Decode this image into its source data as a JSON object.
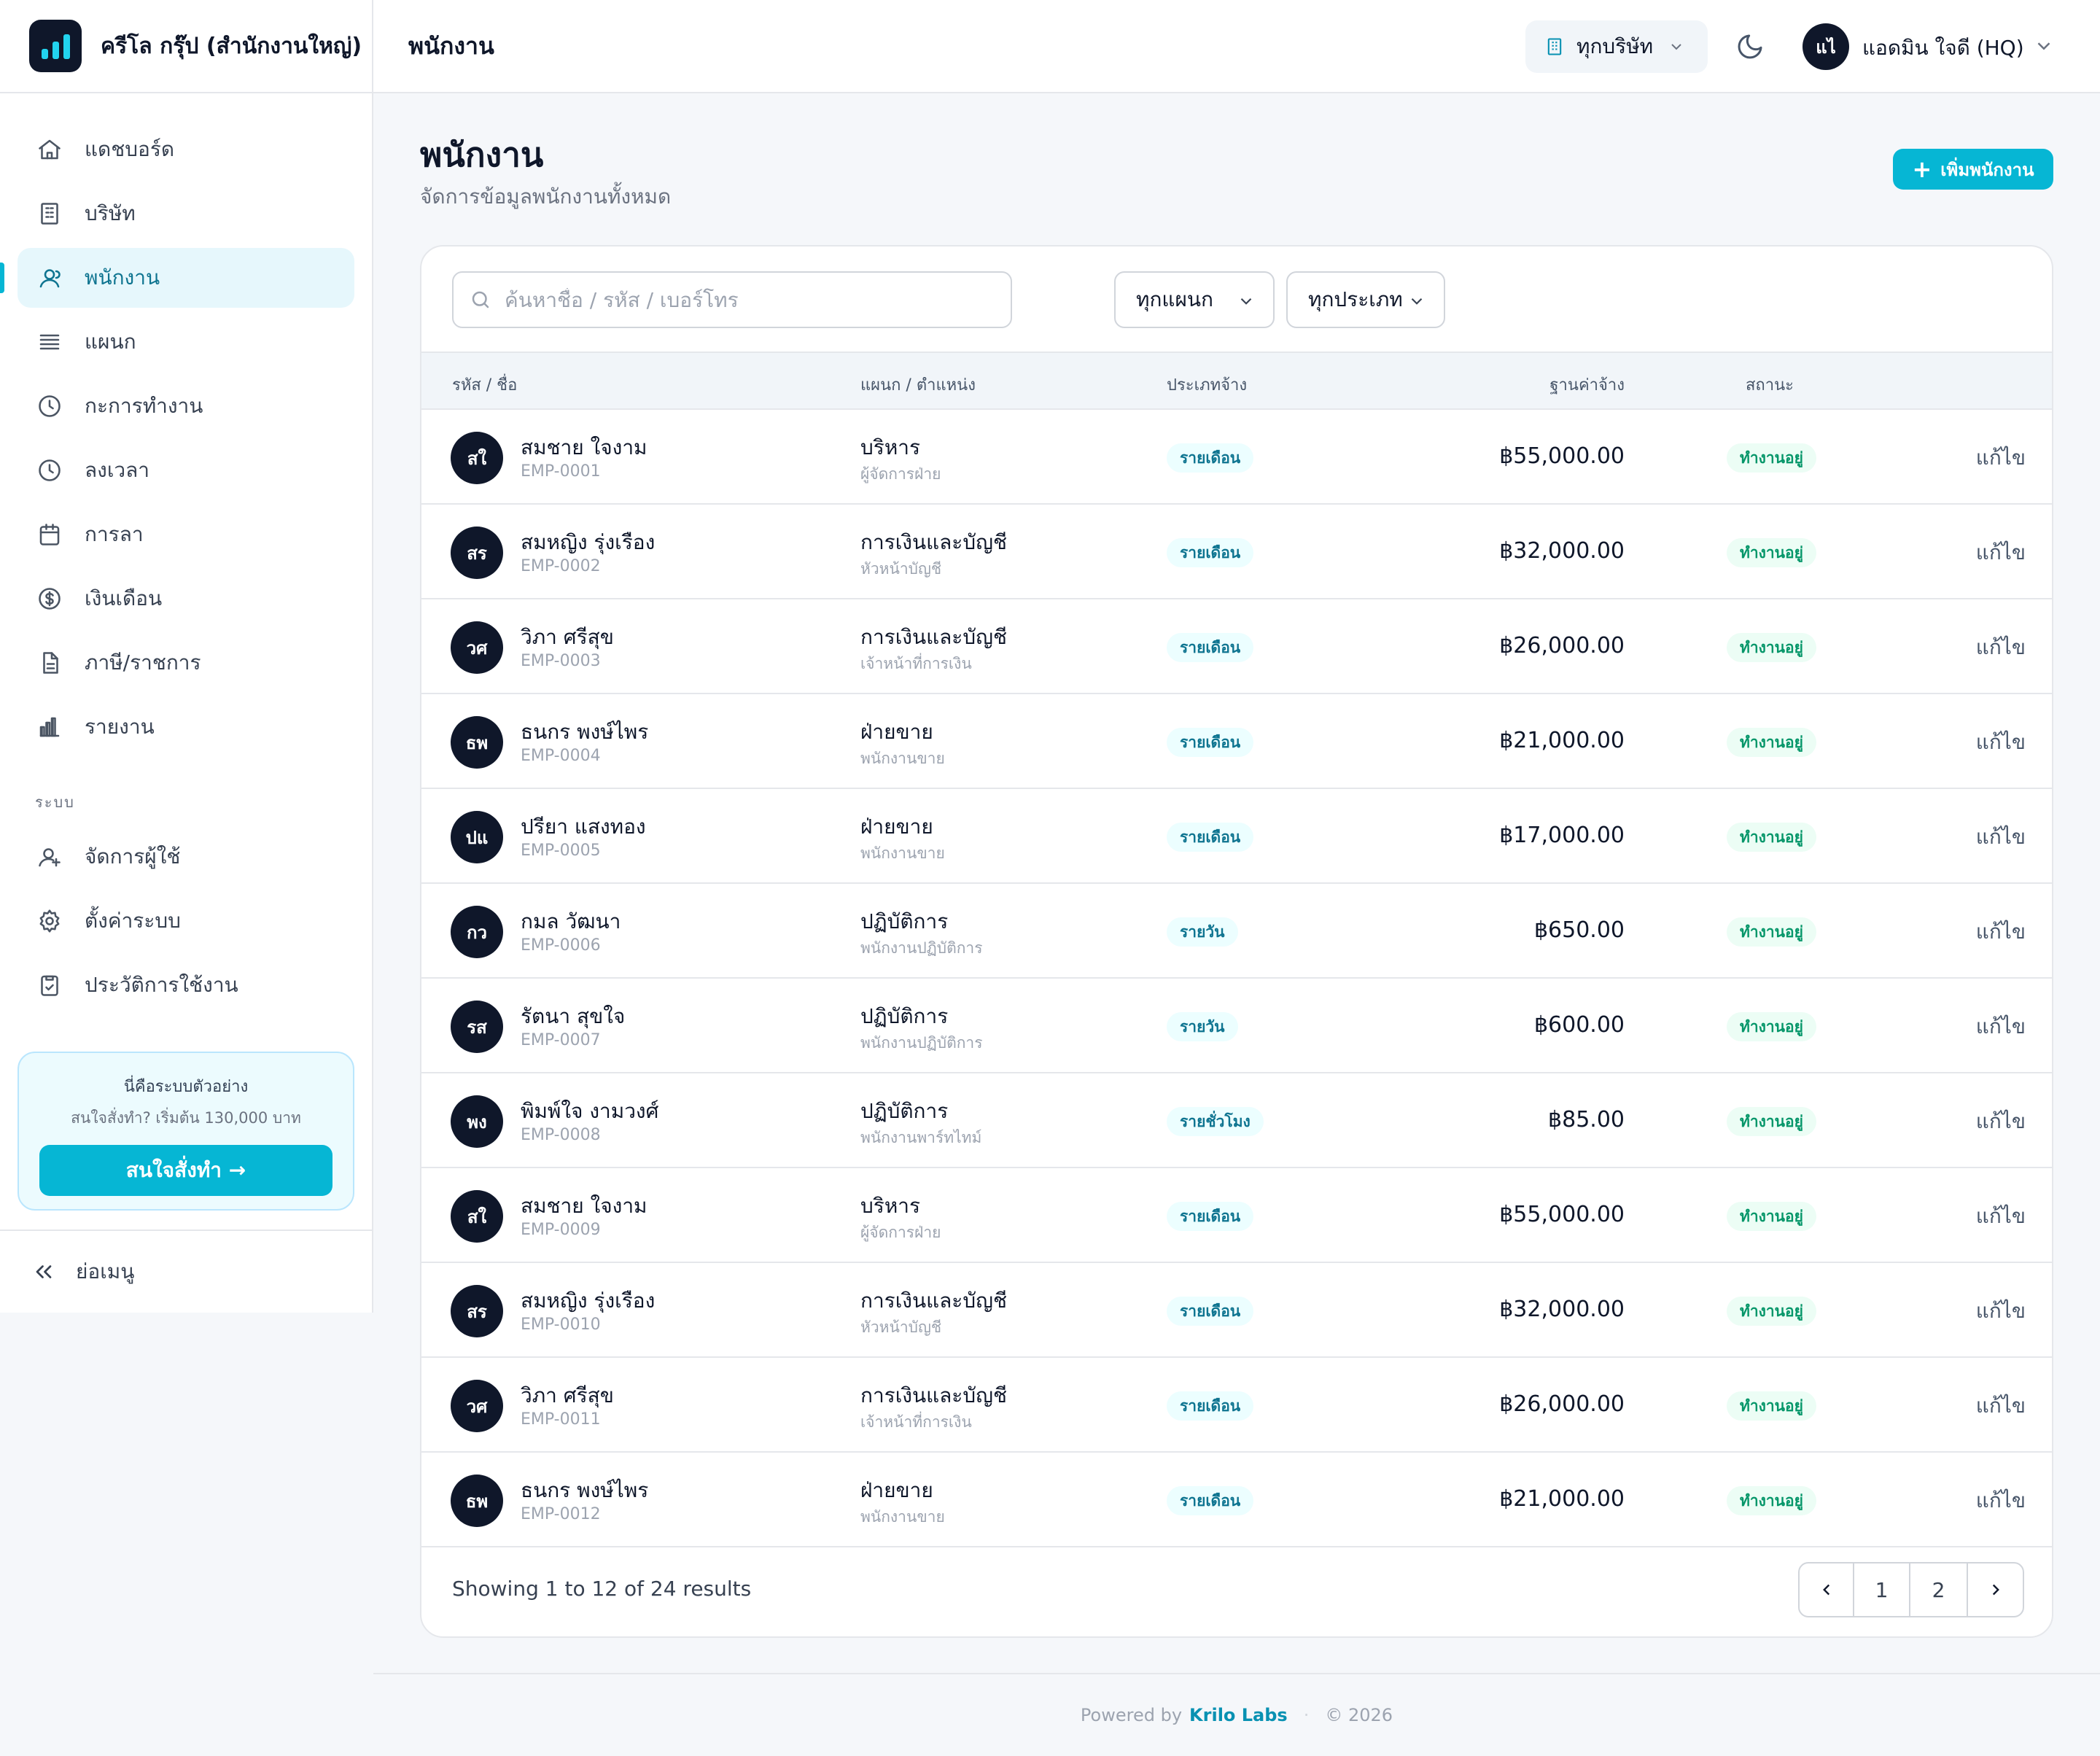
{
  "brand": {
    "name": "ครีโล กรุ๊ป (สำนักงานใหญ่)"
  },
  "sidebar": {
    "items": [
      {
        "label": "แดชบอร์ด",
        "icon": "home-icon"
      },
      {
        "label": "บริษัท",
        "icon": "building-icon"
      },
      {
        "label": "พนักงาน",
        "icon": "users-icon",
        "active": true
      },
      {
        "label": "แผนก",
        "icon": "list-icon"
      },
      {
        "label": "กะการทำงาน",
        "icon": "clock-icon"
      },
      {
        "label": "ลงเวลา",
        "icon": "clock-icon"
      },
      {
        "label": "การลา",
        "icon": "calendar-icon"
      },
      {
        "label": "เงินเดือน",
        "icon": "dollar-icon"
      },
      {
        "label": "ภาษี/ราชการ",
        "icon": "document-icon"
      },
      {
        "label": "รายงาน",
        "icon": "bar-chart-icon"
      }
    ],
    "section_label": "ระบบ",
    "system_items": [
      {
        "label": "จัดการผู้ใช้",
        "icon": "user-manage-icon"
      },
      {
        "label": "ตั้งค่าระบบ",
        "icon": "gear-icon"
      },
      {
        "label": "ประวัติการใช้งาน",
        "icon": "clipboard-icon"
      }
    ],
    "promo": {
      "title": "นี่คือระบบตัวอย่าง",
      "subtitle": "สนใจสั่งทำ? เริ่มต้น 130,000 บาท",
      "button": "สนใจสั่งทำ →"
    },
    "collapse_label": "ย่อเมนู"
  },
  "header": {
    "title": "พนักงาน",
    "company_filter": "ทุกบริษัท",
    "user_initials": "แไ",
    "user_name": "แอดมิน ใจดี (HQ)"
  },
  "page": {
    "title": "พนักงาน",
    "subtitle": "จัดการข้อมูลพนักงานทั้งหมด",
    "add_button": "เพิ่มพนักงาน"
  },
  "search": {
    "placeholder": "ค้นหาชื่อ / รหัส / เบอร์โทร"
  },
  "filters": {
    "department": "ทุกแผนก",
    "type": "ทุกประเภท"
  },
  "table": {
    "columns": [
      "รหัส / ชื่อ",
      "แผนก / ตำแหน่ง",
      "ประเภทจ้าง",
      "ฐานค่าจ้าง",
      "สถานะ"
    ],
    "edit_label": "แก้ไข",
    "rows": [
      {
        "initials": "สใ",
        "name": "สมชาย ใจงาม",
        "code": "EMP-0001",
        "dept": "บริหาร",
        "position": "ผู้จัดการฝ่าย",
        "type": "รายเดือน",
        "salary": "฿55,000.00",
        "status": "ทำงานอยู่"
      },
      {
        "initials": "สร",
        "name": "สมหญิง รุ่งเรือง",
        "code": "EMP-0002",
        "dept": "การเงินและบัญชี",
        "position": "หัวหน้าบัญชี",
        "type": "รายเดือน",
        "salary": "฿32,000.00",
        "status": "ทำงานอยู่"
      },
      {
        "initials": "วศ",
        "name": "วิภา ศรีสุข",
        "code": "EMP-0003",
        "dept": "การเงินและบัญชี",
        "position": "เจ้าหน้าที่การเงิน",
        "type": "รายเดือน",
        "salary": "฿26,000.00",
        "status": "ทำงานอยู่"
      },
      {
        "initials": "ธพ",
        "name": "ธนกร พงษ์ไพร",
        "code": "EMP-0004",
        "dept": "ฝ่ายขาย",
        "position": "พนักงานขาย",
        "type": "รายเดือน",
        "salary": "฿21,000.00",
        "status": "ทำงานอยู่"
      },
      {
        "initials": "ปแ",
        "name": "ปรียา แสงทอง",
        "code": "EMP-0005",
        "dept": "ฝ่ายขาย",
        "position": "พนักงานขาย",
        "type": "รายเดือน",
        "salary": "฿17,000.00",
        "status": "ทำงานอยู่"
      },
      {
        "initials": "กว",
        "name": "กมล วัฒนา",
        "code": "EMP-0006",
        "dept": "ปฏิบัติการ",
        "position": "พนักงานปฏิบัติการ",
        "type": "รายวัน",
        "salary": "฿650.00",
        "status": "ทำงานอยู่"
      },
      {
        "initials": "รส",
        "name": "รัตนา สุขใจ",
        "code": "EMP-0007",
        "dept": "ปฏิบัติการ",
        "position": "พนักงานปฏิบัติการ",
        "type": "รายวัน",
        "salary": "฿600.00",
        "status": "ทำงานอยู่"
      },
      {
        "initials": "พง",
        "name": "พิมพ์ใจ งามวงศ์",
        "code": "EMP-0008",
        "dept": "ปฏิบัติการ",
        "position": "พนักงานพาร์ทไทม์",
        "type": "รายชั่วโมง",
        "salary": "฿85.00",
        "status": "ทำงานอยู่"
      },
      {
        "initials": "สใ",
        "name": "สมชาย ใจงาม",
        "code": "EMP-0009",
        "dept": "บริหาร",
        "position": "ผู้จัดการฝ่าย",
        "type": "รายเดือน",
        "salary": "฿55,000.00",
        "status": "ทำงานอยู่"
      },
      {
        "initials": "สร",
        "name": "สมหญิง รุ่งเรือง",
        "code": "EMP-0010",
        "dept": "การเงินและบัญชี",
        "position": "หัวหน้าบัญชี",
        "type": "รายเดือน",
        "salary": "฿32,000.00",
        "status": "ทำงานอยู่"
      },
      {
        "initials": "วศ",
        "name": "วิภา ศรีสุข",
        "code": "EMP-0011",
        "dept": "การเงินและบัญชี",
        "position": "เจ้าหน้าที่การเงิน",
        "type": "รายเดือน",
        "salary": "฿26,000.00",
        "status": "ทำงานอยู่"
      },
      {
        "initials": "ธพ",
        "name": "ธนกร พงษ์ไพร",
        "code": "EMP-0012",
        "dept": "ฝ่ายขาย",
        "position": "พนักงานขาย",
        "type": "รายเดือน",
        "salary": "฿21,000.00",
        "status": "ทำงานอยู่"
      }
    ]
  },
  "pagination": {
    "summary": "Showing 1 to 12 of 24 results",
    "pages": [
      "1",
      "2"
    ]
  },
  "footer": {
    "powered_by": "Powered by",
    "brand": "Krilo Labs",
    "copyright": "© 2026"
  },
  "colors": {
    "accent": "#06b6d4",
    "dark": "#0f172a",
    "success": "#059669"
  }
}
